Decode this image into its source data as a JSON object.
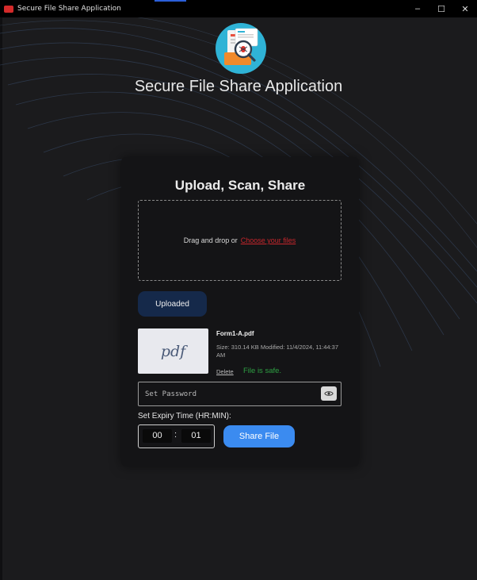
{
  "window": {
    "title": "Secure File Share Application",
    "controls": {
      "minimize": "–",
      "maximize": "☐",
      "close": "✕"
    }
  },
  "header": {
    "app_title": "Secure File Share Application",
    "logo_icon": "document-bug-scan-icon"
  },
  "card": {
    "title": "Upload, Scan, Share",
    "dropzone": {
      "text": "Drag and drop or",
      "link": "Choose your files"
    },
    "uploaded_label": "Uploaded",
    "file": {
      "thumbnail_text": "pdf",
      "name": "Form1-A.pdf",
      "meta": "Size: 310.14 KB   Modified: 11/4/2024, 11:44:37 AM",
      "delete_label": "Delete",
      "status": "File is safe."
    },
    "password": {
      "placeholder": "Set Password",
      "value": ""
    },
    "expiry": {
      "label": "Set Expiry Time (HR:MIN):",
      "hours": "00",
      "separator": ":",
      "minutes": "01"
    },
    "share_label": "Share File"
  },
  "colors": {
    "background": "#1b1b1d",
    "card": "#141416",
    "uploaded_button": "#15294a",
    "share_button": "#3b8bf0",
    "link": "#c8262c",
    "safe": "#2ea043"
  }
}
